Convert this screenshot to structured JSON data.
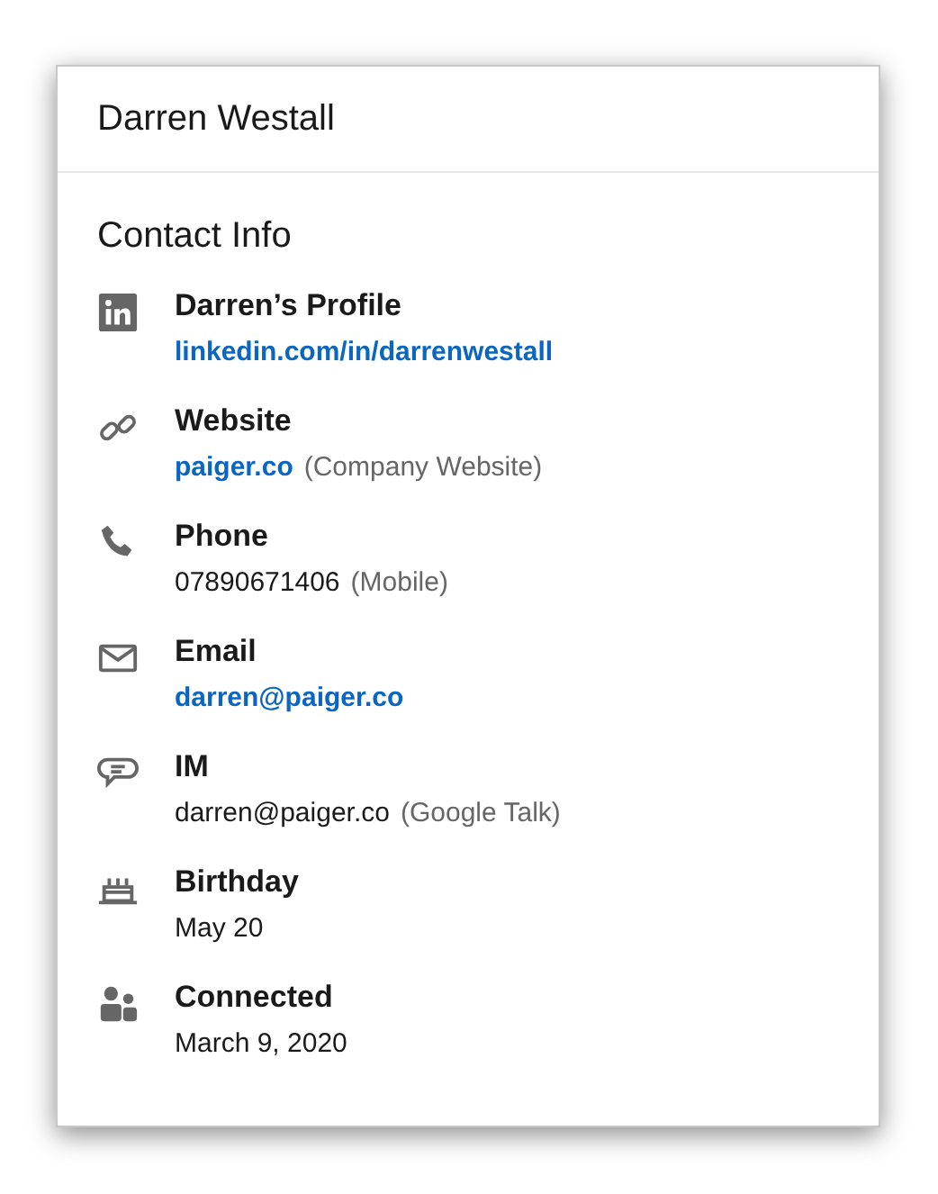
{
  "header": {
    "title": "Darren Westall"
  },
  "section_title": "Contact Info",
  "items": [
    {
      "kind": "linkedin",
      "label": "Darren’s Profile",
      "value": "linkedin.com/in/darrenwestall",
      "link": true
    },
    {
      "kind": "website",
      "label": "Website",
      "value": "paiger.co",
      "link": true,
      "note": "(Company Website)"
    },
    {
      "kind": "phone",
      "label": "Phone",
      "value": "07890671406",
      "link": false,
      "note": "(Mobile)"
    },
    {
      "kind": "email",
      "label": "Email",
      "value": "darren@paiger.co",
      "link": true
    },
    {
      "kind": "im",
      "label": "IM",
      "value": "darren@paiger.co",
      "link": false,
      "note": "(Google Talk)"
    },
    {
      "kind": "birthday",
      "label": "Birthday",
      "value": "May 20",
      "link": false
    },
    {
      "kind": "connected",
      "label": "Connected",
      "value": "March 9, 2020",
      "link": false
    }
  ]
}
